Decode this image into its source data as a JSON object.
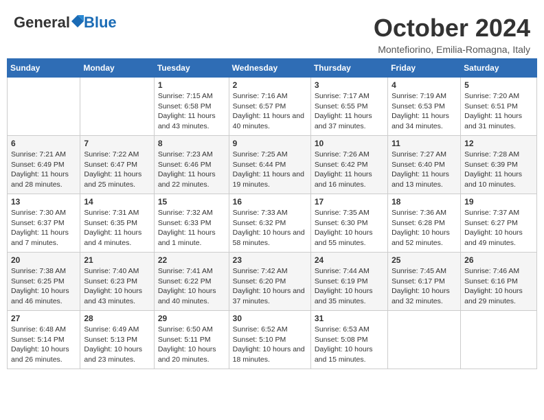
{
  "header": {
    "logo_general": "General",
    "logo_blue": "Blue",
    "month_title": "October 2024",
    "location": "Montefiorino, Emilia-Romagna, Italy"
  },
  "days_of_week": [
    "Sunday",
    "Monday",
    "Tuesday",
    "Wednesday",
    "Thursday",
    "Friday",
    "Saturday"
  ],
  "weeks": [
    [
      {
        "day": "",
        "info": ""
      },
      {
        "day": "",
        "info": ""
      },
      {
        "day": "1",
        "info": "Sunrise: 7:15 AM\nSunset: 6:58 PM\nDaylight: 11 hours and 43 minutes."
      },
      {
        "day": "2",
        "info": "Sunrise: 7:16 AM\nSunset: 6:57 PM\nDaylight: 11 hours and 40 minutes."
      },
      {
        "day": "3",
        "info": "Sunrise: 7:17 AM\nSunset: 6:55 PM\nDaylight: 11 hours and 37 minutes."
      },
      {
        "day": "4",
        "info": "Sunrise: 7:19 AM\nSunset: 6:53 PM\nDaylight: 11 hours and 34 minutes."
      },
      {
        "day": "5",
        "info": "Sunrise: 7:20 AM\nSunset: 6:51 PM\nDaylight: 11 hours and 31 minutes."
      }
    ],
    [
      {
        "day": "6",
        "info": "Sunrise: 7:21 AM\nSunset: 6:49 PM\nDaylight: 11 hours and 28 minutes."
      },
      {
        "day": "7",
        "info": "Sunrise: 7:22 AM\nSunset: 6:47 PM\nDaylight: 11 hours and 25 minutes."
      },
      {
        "day": "8",
        "info": "Sunrise: 7:23 AM\nSunset: 6:46 PM\nDaylight: 11 hours and 22 minutes."
      },
      {
        "day": "9",
        "info": "Sunrise: 7:25 AM\nSunset: 6:44 PM\nDaylight: 11 hours and 19 minutes."
      },
      {
        "day": "10",
        "info": "Sunrise: 7:26 AM\nSunset: 6:42 PM\nDaylight: 11 hours and 16 minutes."
      },
      {
        "day": "11",
        "info": "Sunrise: 7:27 AM\nSunset: 6:40 PM\nDaylight: 11 hours and 13 minutes."
      },
      {
        "day": "12",
        "info": "Sunrise: 7:28 AM\nSunset: 6:39 PM\nDaylight: 11 hours and 10 minutes."
      }
    ],
    [
      {
        "day": "13",
        "info": "Sunrise: 7:30 AM\nSunset: 6:37 PM\nDaylight: 11 hours and 7 minutes."
      },
      {
        "day": "14",
        "info": "Sunrise: 7:31 AM\nSunset: 6:35 PM\nDaylight: 11 hours and 4 minutes."
      },
      {
        "day": "15",
        "info": "Sunrise: 7:32 AM\nSunset: 6:33 PM\nDaylight: 11 hours and 1 minute."
      },
      {
        "day": "16",
        "info": "Sunrise: 7:33 AM\nSunset: 6:32 PM\nDaylight: 10 hours and 58 minutes."
      },
      {
        "day": "17",
        "info": "Sunrise: 7:35 AM\nSunset: 6:30 PM\nDaylight: 10 hours and 55 minutes."
      },
      {
        "day": "18",
        "info": "Sunrise: 7:36 AM\nSunset: 6:28 PM\nDaylight: 10 hours and 52 minutes."
      },
      {
        "day": "19",
        "info": "Sunrise: 7:37 AM\nSunset: 6:27 PM\nDaylight: 10 hours and 49 minutes."
      }
    ],
    [
      {
        "day": "20",
        "info": "Sunrise: 7:38 AM\nSunset: 6:25 PM\nDaylight: 10 hours and 46 minutes."
      },
      {
        "day": "21",
        "info": "Sunrise: 7:40 AM\nSunset: 6:23 PM\nDaylight: 10 hours and 43 minutes."
      },
      {
        "day": "22",
        "info": "Sunrise: 7:41 AM\nSunset: 6:22 PM\nDaylight: 10 hours and 40 minutes."
      },
      {
        "day": "23",
        "info": "Sunrise: 7:42 AM\nSunset: 6:20 PM\nDaylight: 10 hours and 37 minutes."
      },
      {
        "day": "24",
        "info": "Sunrise: 7:44 AM\nSunset: 6:19 PM\nDaylight: 10 hours and 35 minutes."
      },
      {
        "day": "25",
        "info": "Sunrise: 7:45 AM\nSunset: 6:17 PM\nDaylight: 10 hours and 32 minutes."
      },
      {
        "day": "26",
        "info": "Sunrise: 7:46 AM\nSunset: 6:16 PM\nDaylight: 10 hours and 29 minutes."
      }
    ],
    [
      {
        "day": "27",
        "info": "Sunrise: 6:48 AM\nSunset: 5:14 PM\nDaylight: 10 hours and 26 minutes."
      },
      {
        "day": "28",
        "info": "Sunrise: 6:49 AM\nSunset: 5:13 PM\nDaylight: 10 hours and 23 minutes."
      },
      {
        "day": "29",
        "info": "Sunrise: 6:50 AM\nSunset: 5:11 PM\nDaylight: 10 hours and 20 minutes."
      },
      {
        "day": "30",
        "info": "Sunrise: 6:52 AM\nSunset: 5:10 PM\nDaylight: 10 hours and 18 minutes."
      },
      {
        "day": "31",
        "info": "Sunrise: 6:53 AM\nSunset: 5:08 PM\nDaylight: 10 hours and 15 minutes."
      },
      {
        "day": "",
        "info": ""
      },
      {
        "day": "",
        "info": ""
      }
    ]
  ]
}
